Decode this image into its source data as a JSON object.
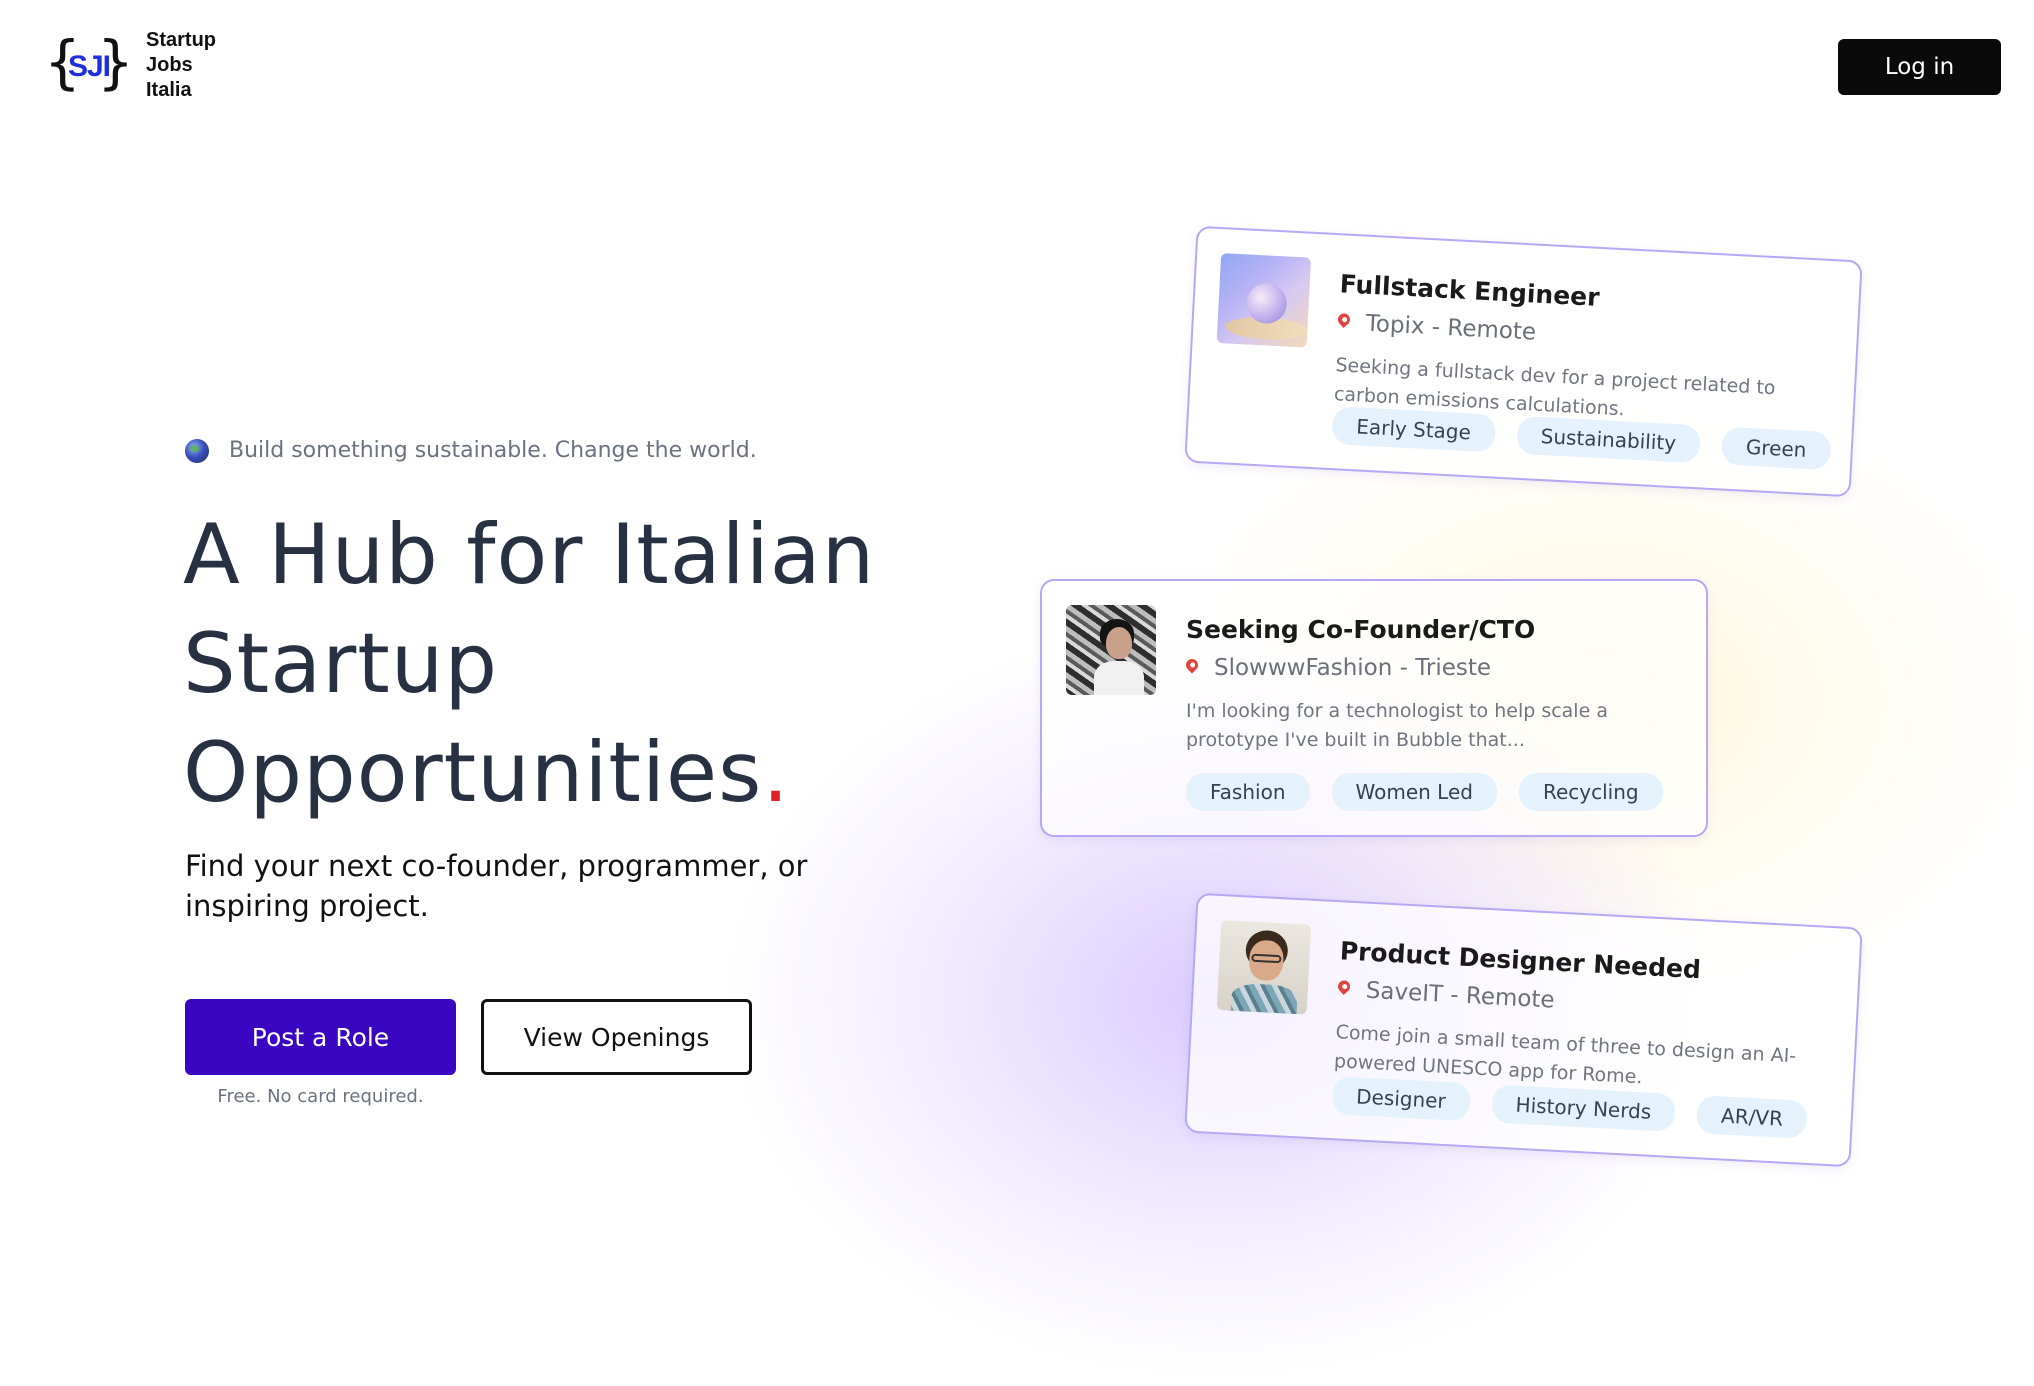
{
  "header": {
    "logo_initials": "SJI",
    "logo_lines": [
      "Startup",
      "Jobs",
      "Italia"
    ],
    "login_label": "Log in"
  },
  "hero": {
    "tagline": "Build something sustainable. Change the world.",
    "headline_lines": [
      "A Hub for Italian",
      "Startup",
      "Opportunities"
    ],
    "headline_punct": ".",
    "subhead": "Find your next co-founder, programmer, or inspiring project.",
    "primary_cta": "Post a Role",
    "secondary_cta": "View Openings",
    "cta_note": "Free. No card required."
  },
  "cards": [
    {
      "title": "Fullstack Engineer",
      "location": "Topix - Remote",
      "description": "Seeking a fullstack dev for a project related to carbon emissions calculations.",
      "tags": [
        "Early Stage",
        "Sustainability",
        "Green"
      ]
    },
    {
      "title": "Seeking Co-Founder/CTO",
      "location": "SlowwwFashion - Trieste",
      "description": "I'm looking for a technologist to help scale a prototype I've built in Bubble that...",
      "tags": [
        "Fashion",
        "Women Led",
        "Recycling"
      ]
    },
    {
      "title": "Product Designer Needed",
      "location": "SaveIT - Remote",
      "description": "Come join a small team of three to design an AI-powered UNESCO app for Rome.",
      "tags": [
        "Designer",
        "History Nerds",
        "AR/VR"
      ]
    }
  ],
  "icons": {
    "logo": "braces-logo-icon",
    "tagline": "globe-icon",
    "location": "pin-icon"
  },
  "colors": {
    "primary": "#3a06c2",
    "logo_accent": "#1d2fe0",
    "headline_dot": "#e02424",
    "tag_bg": "#e5f2fb",
    "card_border": "#b7a8f5"
  }
}
